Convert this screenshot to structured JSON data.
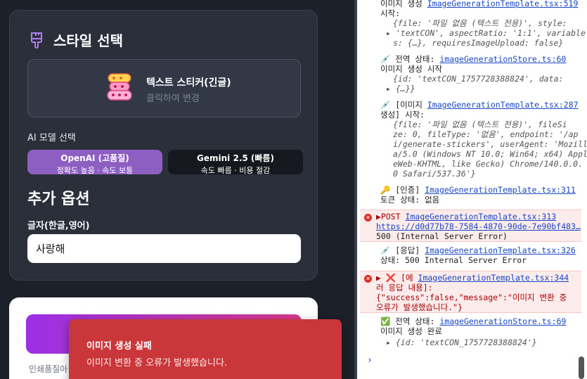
{
  "panel": {
    "title": "스타일 선택",
    "style_card": {
      "name": "텍스트 스티커(긴글)",
      "hint": "클릭하여 변경"
    },
    "model_label": "AI 모델 선택",
    "models": [
      {
        "name": "OpenAI (고품질)",
        "desc": "정확도 높음 · 속도 보통",
        "selected": true
      },
      {
        "name": "Gemini 2.5 (빠름)",
        "desc": "속도 빠름 · 비용 절감",
        "selected": false
      }
    ],
    "options_title": "추가 옵션",
    "text_label": "글자(한글,영어)",
    "text_value": "사랑해"
  },
  "card2": {
    "note": "인쇄품질아"
  },
  "toast": {
    "title": "이미지 생성 실패",
    "message": "이미지 변환 중 오류가 발생했습니다."
  },
  "console": {
    "e1": {
      "l1a": "이미지 생성 ",
      "l1b": "ImageGenerationTemplate.tsx:519",
      "l2": "시작:",
      "l3": "{file: '파일 없음 (텍스트 전용)', style:",
      "l4": "'textCON', aspectRatio: '1:1', variable",
      "l5": "s: {…}, requiresImageUpload: false}"
    },
    "e2": {
      "l1a": "💉 전역 상태: ",
      "l1b": "imageGenerationStore.ts:60",
      "l2": "이미지 생성 시작",
      "l3": "{id: 'textCON_1757728388824', data:",
      "l4": "{…}}"
    },
    "e3": {
      "l1a": "💉 [이미지 ",
      "l1b": "ImageGenerationTemplate.tsx:287",
      "l2": "생성] 시작:",
      "l3": "{file: '파일 없음 (텍스트 전용)', fileSi",
      "l4": "ze: 0, fileType: '없음', endpoint: '/ap",
      "l5": "i/generate-stickers', userAgent: 'Mozill",
      "l6": "a/5.0 (Windows NT 10.0; Win64; x64) Apple",
      "l7": "eWeb-KHTML, like Gecko) Chrome/140.0.0.",
      "l8": "0 Safari/537.36'}"
    },
    "e4": {
      "l1a": "🔑 [인증] ",
      "l1b": "ImageGenerationTemplate.tsx:311",
      "l2": "토큰 상태: 없음"
    },
    "e5": {
      "l1a": "▶POST ",
      "l1b": "ImageGenerationTemplate.tsx:313",
      "l2": "https://d0d77b78-7584-4870-90de-7e90bf483…",
      "l3": "500 (Internal Server Error)"
    },
    "e6": {
      "l1a": "💉 [응답] ",
      "l1b": "ImageGenerationTemplate.tsx:326",
      "l2": "상태: 500 Internal Server Error"
    },
    "e7": {
      "l1a": "▶ ❌ [에 ",
      "l1b": "ImageGenerationTemplate.tsx:344",
      "l2": "러 응답 내용]:",
      "l3": "{\"success\":false,\"message\":\"이미지 변환 중",
      "l4": "오류가 발생했습니다.\"}"
    },
    "e8": {
      "l1a": "✅ 전역 상태: ",
      "l1b": "imageGenerationStore.ts:69",
      "l2": "이미지 생성 완료",
      "l3": "{id: 'textCON_1757728388824'}"
    },
    "prompt": "›"
  }
}
